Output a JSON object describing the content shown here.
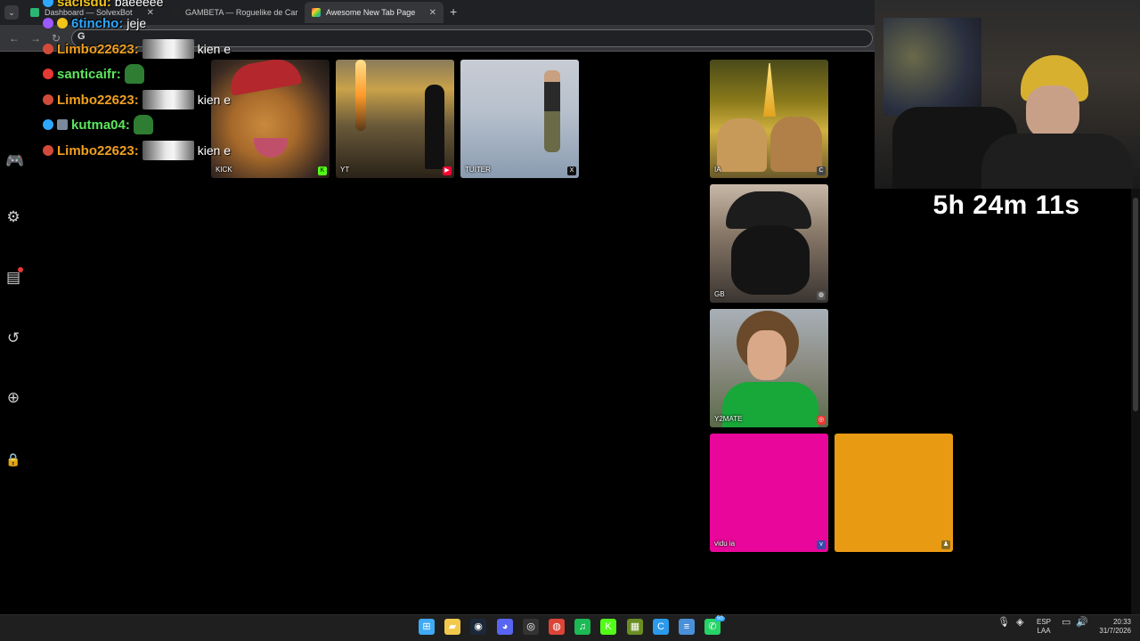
{
  "browser": {
    "tabs": [
      {
        "title": "Dashboard — SolvexBot",
        "active": false
      },
      {
        "title": "GAMBETA — Roguelike de Car",
        "active": false
      },
      {
        "title": "Awesome New Tab Page",
        "active": true
      }
    ],
    "new_tab_symbol": "+",
    "close_symbol": "✕",
    "menu_symbol": "⌄",
    "nav": {
      "back": "←",
      "forward": "→",
      "reload": "↻"
    },
    "omnibox_letter": "G"
  },
  "chat": [
    {
      "user": "sacisdu:",
      "message": "baeeeee",
      "color": "#f0c419"
    },
    {
      "user": "6tincho:",
      "message": "jeje",
      "color": "#2ea8ff"
    },
    {
      "user": "Limbo22623:",
      "message": "kien e",
      "color": "#f0a020",
      "emote": "dog"
    },
    {
      "user": "santicaifr:",
      "message": "",
      "color": "#5ce65c",
      "emote": "green"
    },
    {
      "user": "Limbo22623:",
      "message": "kien e",
      "color": "#f0a020",
      "emote": "dog"
    },
    {
      "user": "kutma04:",
      "message": "",
      "color": "#5ce65c",
      "emote": "green"
    },
    {
      "user": "Limbo22623:",
      "message": "kien e",
      "color": "#f0a020",
      "emote": "dog"
    }
  ],
  "sidebar": [
    {
      "icon": "gamepad-icon",
      "glyph": "🎮"
    },
    {
      "icon": "gear-icon",
      "glyph": "⚙"
    },
    {
      "icon": "widgets-icon",
      "glyph": "▤"
    },
    {
      "icon": "history-icon",
      "glyph": "↺"
    },
    {
      "icon": "add-icon",
      "glyph": "⊕"
    },
    {
      "icon": "lock-icon",
      "glyph": "🔒"
    }
  ],
  "tiles": [
    {
      "label": "KICK",
      "icon": "kick-icon",
      "icon_glyph": "K",
      "icon_color": "#53fc18"
    },
    {
      "label": "YT",
      "icon": "youtube-icon",
      "icon_glyph": "▶",
      "icon_color": "#ff0033"
    },
    {
      "label": "TUITER",
      "icon": "x-icon",
      "icon_glyph": "X",
      "icon_color": "#111111"
    },
    {
      "label": "IA",
      "icon": "chatgpt-icon",
      "icon_glyph": "C",
      "icon_color": "#444444"
    },
    {
      "label": "GB",
      "icon": "globe-icon",
      "icon_glyph": "◍",
      "icon_color": "#555555"
    },
    {
      "label": "Y2MATE",
      "icon": "y2mate-icon",
      "icon_glyph": "◎",
      "icon_color": "#e53935"
    },
    {
      "label": "vidu ia",
      "icon": "vidu-icon",
      "icon_glyph": "v",
      "icon_color": "#3949ab"
    },
    {
      "label": "",
      "icon": "person-icon",
      "icon_glyph": "♟",
      "icon_color": "#8a6d1f"
    }
  ],
  "timer": "5h 24m 11s",
  "taskbar": {
    "apps": [
      {
        "name": "windows-start-icon",
        "glyph": "⊞",
        "color": "#3fa9f5"
      },
      {
        "name": "file-explorer-icon",
        "glyph": "▰",
        "color": "#f2c94c"
      },
      {
        "name": "steam-icon",
        "glyph": "◉",
        "color": "#1b2838"
      },
      {
        "name": "discord-icon",
        "glyph": "◕",
        "color": "#5865f2"
      },
      {
        "name": "obs-icon",
        "glyph": "◎",
        "color": "#333333"
      },
      {
        "name": "chrome-icon",
        "glyph": "◍",
        "color": "#db4437"
      },
      {
        "name": "spotify-icon",
        "glyph": "♫",
        "color": "#1db954"
      },
      {
        "name": "kick-app-icon",
        "glyph": "K",
        "color": "#53fc18"
      },
      {
        "name": "minecraft-icon",
        "glyph": "▦",
        "color": "#6b8e23"
      },
      {
        "name": "ccleaner-icon",
        "glyph": "C",
        "color": "#2b9aeb"
      },
      {
        "name": "notepad-icon",
        "glyph": "≡",
        "color": "#4a90d9"
      },
      {
        "name": "whatsapp-icon",
        "glyph": "✆",
        "color": "#25d366"
      }
    ],
    "whatsapp_badge": "50",
    "language": "ESP",
    "layout": "LAA",
    "time": "20:33",
    "date": "31/7/2026"
  }
}
